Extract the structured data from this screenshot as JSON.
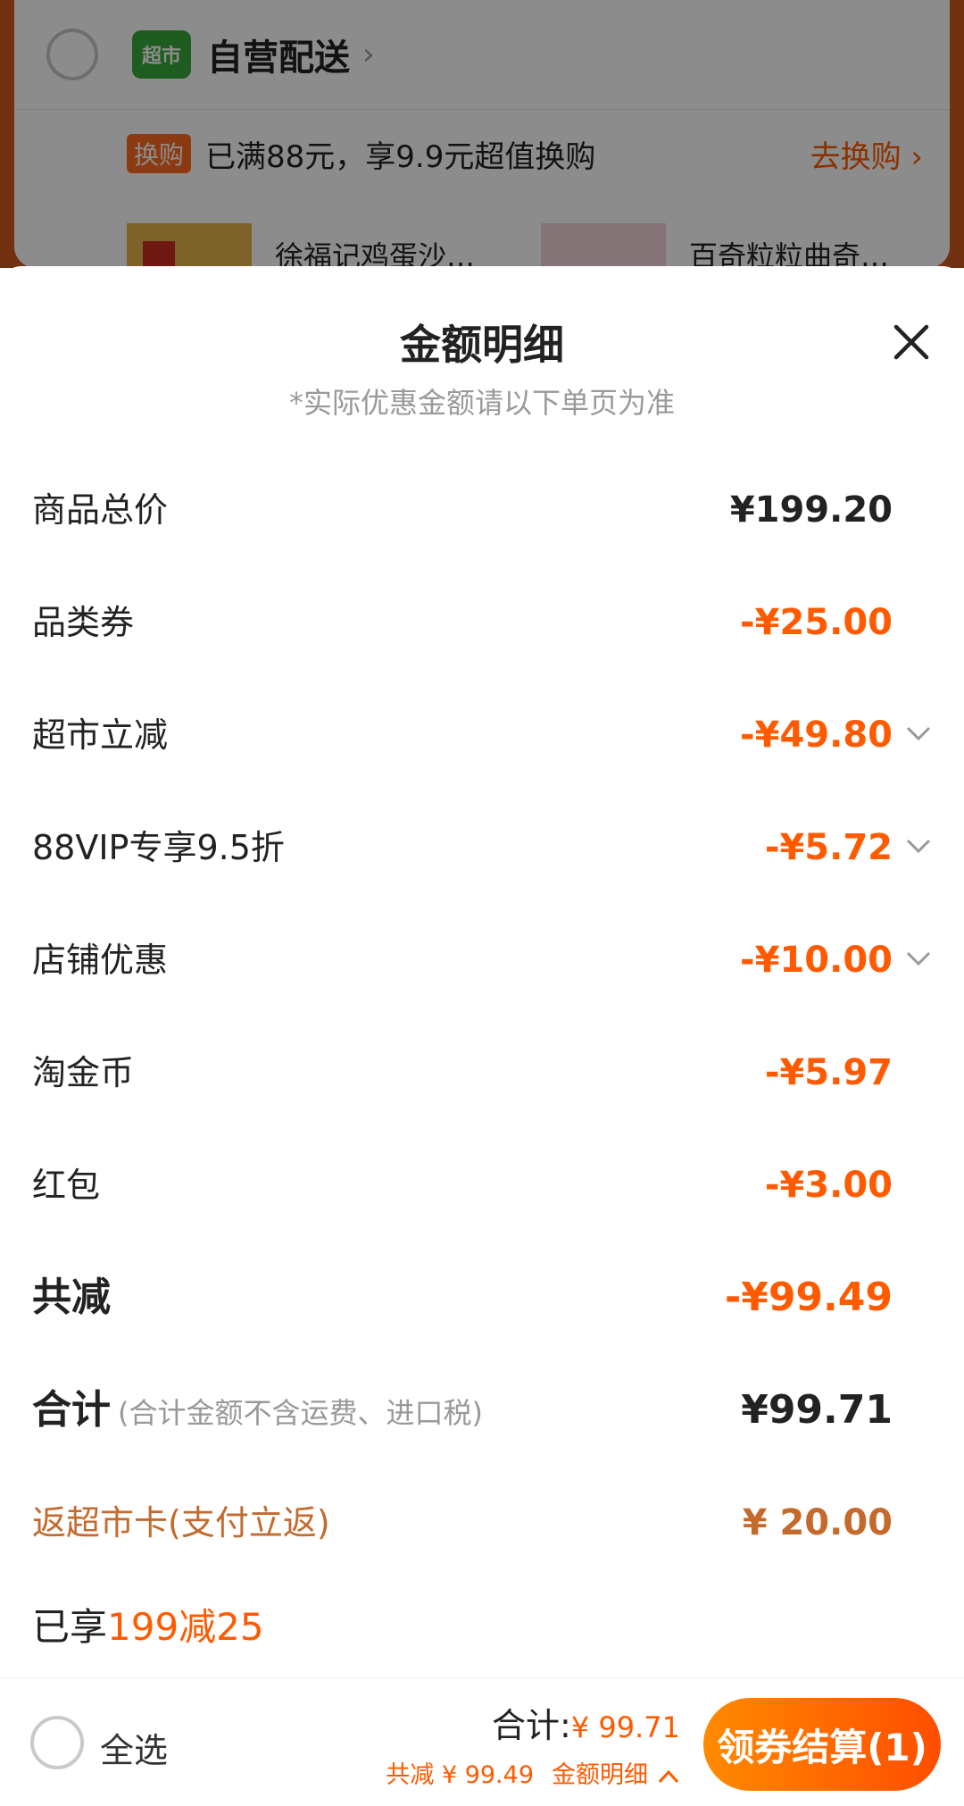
{
  "background_cart": {
    "store_logo_text": "超市",
    "store_name": "自营配送",
    "swap_badge": "换购",
    "swap_text": "已满88元，享9.9元超值换购",
    "swap_link": "去换购",
    "products": [
      "徐福记鸡蛋沙…",
      "百奇粒粒曲奇…"
    ]
  },
  "sheet": {
    "title": "金额明细",
    "subtitle": "*实际优惠金额请以下单页为准",
    "rows": [
      {
        "label": "商品总价",
        "value": "¥199.20",
        "expandable": false
      },
      {
        "label": "品类券",
        "value": "-¥25.00",
        "expandable": false
      },
      {
        "label": "超市立减",
        "value": "-¥49.80",
        "expandable": true
      },
      {
        "label": "88VIP专享9.5折",
        "value": "-¥5.72",
        "expandable": true
      },
      {
        "label": "店铺优惠",
        "value": "-¥10.00",
        "expandable": true
      },
      {
        "label": "淘金币",
        "value": "-¥5.97",
        "expandable": false
      },
      {
        "label": "红包",
        "value": "-¥3.00",
        "expandable": false
      }
    ],
    "total_discount": {
      "label": "共减",
      "value": "-¥99.49"
    },
    "sum": {
      "label": "合计",
      "note": "(合计金额不含运费、进口税)",
      "value": "¥99.71"
    },
    "rebate": {
      "label": "返超市卡(支付立返)",
      "value": "¥ 20.00"
    },
    "enjoyed": {
      "prefix": "已享",
      "highlight": "199减25"
    }
  },
  "bottom_bar": {
    "select_all": "全选",
    "total_label": "合计:",
    "total_amount": "¥ 99.71",
    "discount_text": "共减 ¥ 99.49",
    "detail_link": "金额明细",
    "checkout_button": "领券结算(1)"
  },
  "colors": {
    "accent": "#ff5a00",
    "rebate": "#c46a2d"
  }
}
